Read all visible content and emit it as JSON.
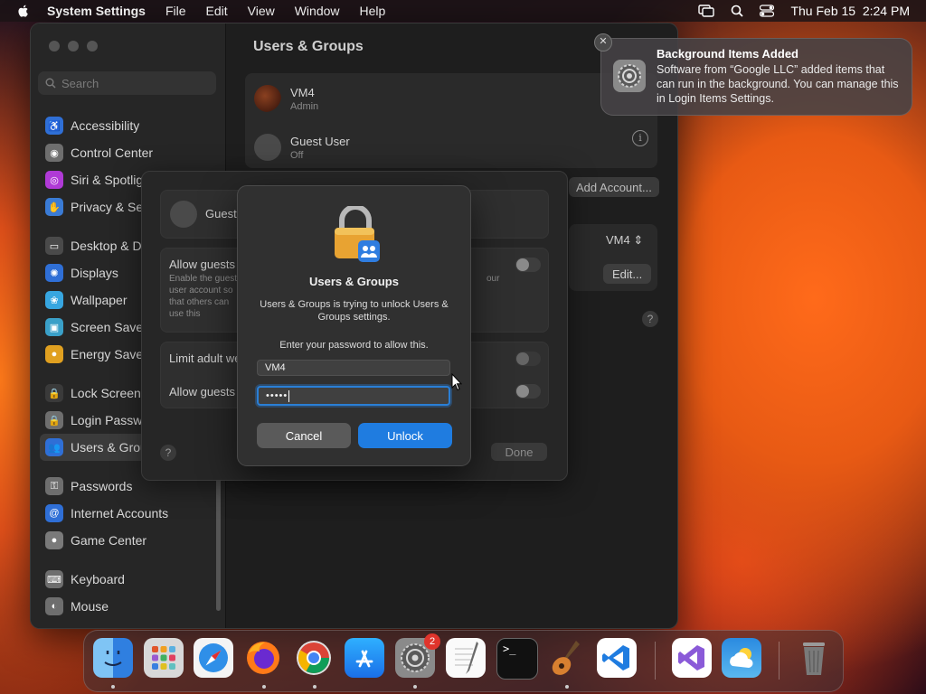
{
  "menubar": {
    "app_name": "System Settings",
    "menus": [
      "File",
      "Edit",
      "View",
      "Window",
      "Help"
    ],
    "datetime": "Thu Feb 15  2:24 PM"
  },
  "window": {
    "search_placeholder": "Search",
    "title": "Users & Groups",
    "sidebar": {
      "items": [
        {
          "label": "Accessibility",
          "color": "#2f6fd6",
          "glyph": "♿"
        },
        {
          "label": "Control Center",
          "color": "#6e6e6e",
          "glyph": "◉"
        },
        {
          "label": "Siri & Spotlight",
          "color": "#b03ad6",
          "glyph": "◎"
        },
        {
          "label": "Privacy & Security",
          "color": "#3a7bd5",
          "glyph": "✋"
        },
        {
          "label": "Desktop & Dock",
          "color": "#4a4a4a",
          "glyph": "▭"
        },
        {
          "label": "Displays",
          "color": "#2f6fd6",
          "glyph": "✺"
        },
        {
          "label": "Wallpaper",
          "color": "#37a6e0",
          "glyph": "❀"
        },
        {
          "label": "Screen Saver",
          "color": "#3aa0c8",
          "glyph": "▣"
        },
        {
          "label": "Energy Saver",
          "color": "#e0a020",
          "glyph": "●"
        },
        {
          "label": "Lock Screen",
          "color": "#3a3a3a",
          "glyph": "🔒"
        },
        {
          "label": "Login Password",
          "color": "#6e6e6e",
          "glyph": "🔒"
        },
        {
          "label": "Users & Groups",
          "color": "#2f6fd6",
          "glyph": "👥"
        },
        {
          "label": "Passwords",
          "color": "#6e6e6e",
          "glyph": "⚿"
        },
        {
          "label": "Internet Accounts",
          "color": "#2f6fd6",
          "glyph": "@"
        },
        {
          "label": "Game Center",
          "color": "#7a7a7a",
          "glyph": "●"
        },
        {
          "label": "Keyboard",
          "color": "#6e6e6e",
          "glyph": "⌨"
        },
        {
          "label": "Mouse",
          "color": "#6e6e6e",
          "glyph": "◐"
        }
      ]
    },
    "users": [
      {
        "name": "VM4",
        "role": "Admin"
      },
      {
        "name": "Guest User",
        "role": "Off"
      }
    ],
    "add_account_label": "Add Account...",
    "auto_login_user": "VM4",
    "edit_label": "Edit..."
  },
  "sheet": {
    "guest_label": "Guest User",
    "allow_guests_label": "Allow guests to log in to this computer",
    "allow_guests_desc": "Enable the guest user account so that others can use this computer. Login a password. Use FileVault is turned on",
    "desc_right_fragment": "our",
    "limit_adult_label": "Limit adult websites",
    "allow_guest_connect_label": "Allow guests to connect to shared folders",
    "done_label": "Done"
  },
  "dialog": {
    "title": "Users & Groups",
    "message": "Users & Groups is trying to unlock Users & Groups settings.",
    "prompt": "Enter your password to allow this.",
    "username": "VM4",
    "password_mask": "•••••",
    "cancel_label": "Cancel",
    "unlock_label": "Unlock"
  },
  "notification": {
    "title": "Background Items Added",
    "body": "Software from “Google LLC” added items that can run in the background. You can manage this in Login Items Settings.",
    "close_glyph": "✕"
  },
  "dock": {
    "apps": [
      "Finder",
      "Launchpad",
      "Safari",
      "Firefox",
      "Chrome",
      "App Store",
      "System Settings",
      "TextEdit",
      "Terminal",
      "Instruments",
      "Visual Studio Code",
      "Visual Studio",
      "Weather",
      "Trash"
    ],
    "settings_badge": "2"
  }
}
